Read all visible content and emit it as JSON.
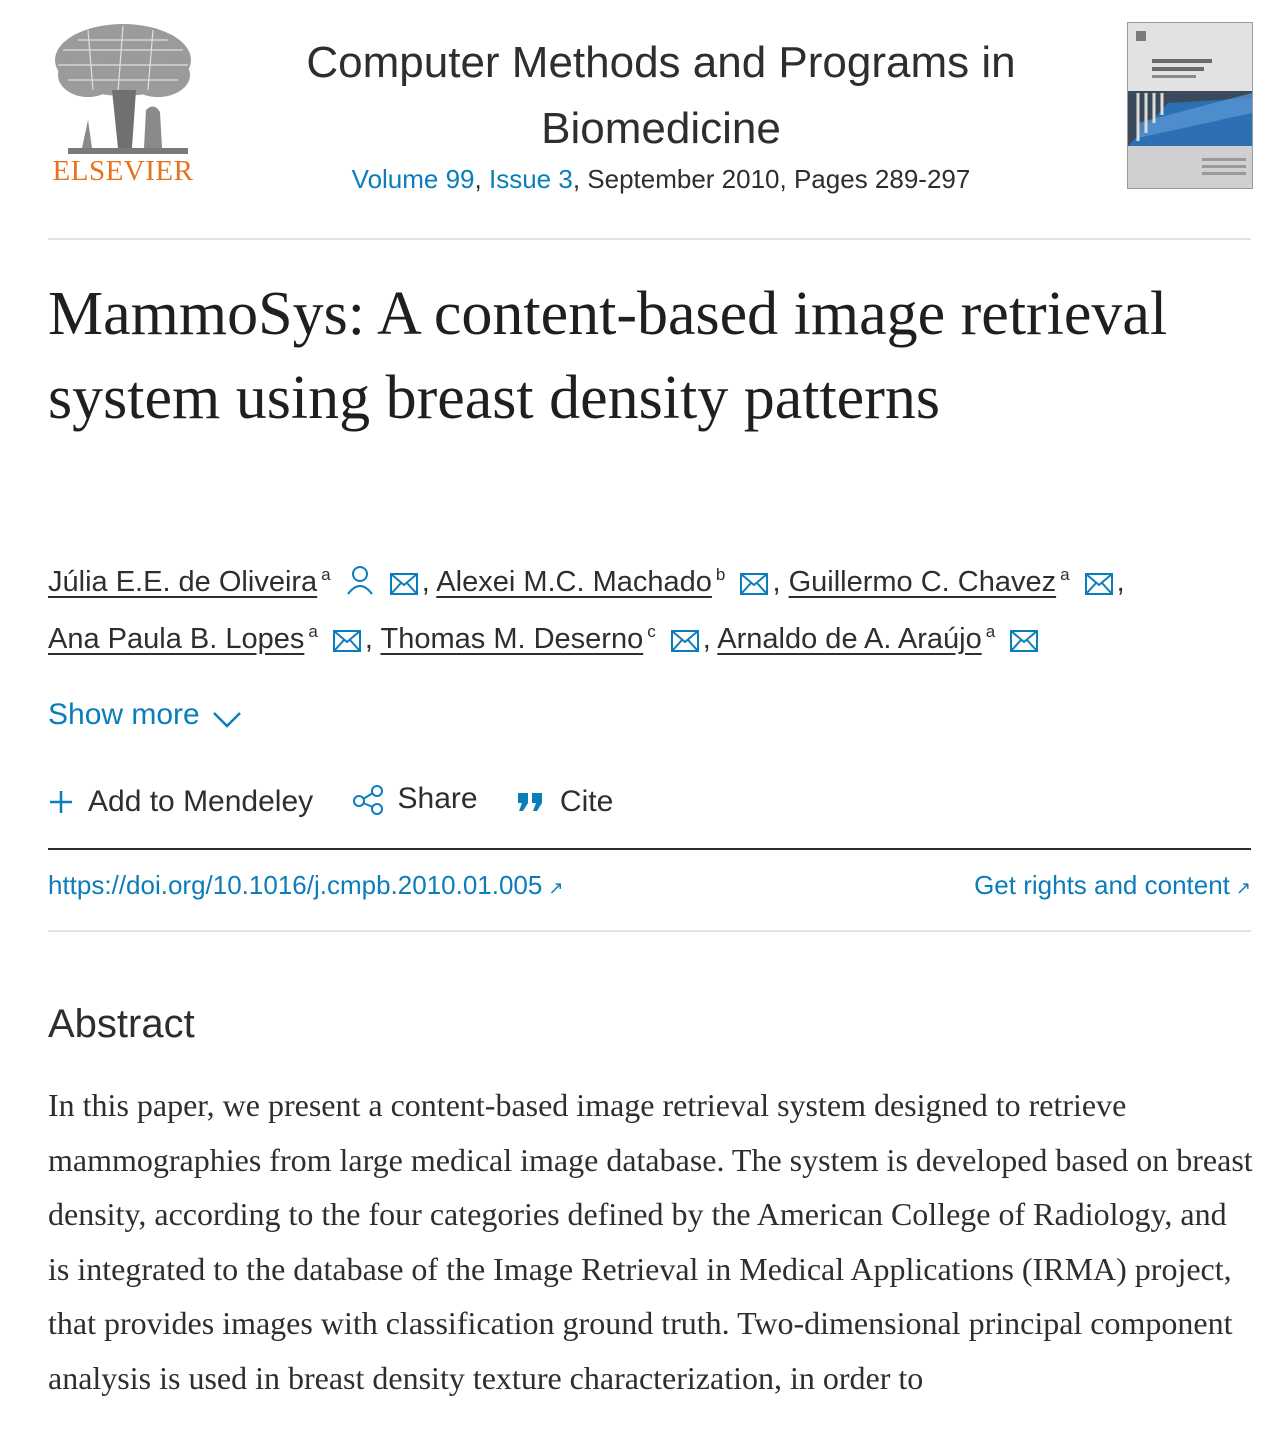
{
  "header": {
    "publisher": "ELSEVIER",
    "journal_title": "Computer Methods and Programs in Biomedicine",
    "volume_label": "Volume 99",
    "issue_label": "Issue 3",
    "sep": ",",
    "date_pages": ", September 2010, Pages 289-297"
  },
  "article": {
    "title": "MammoSys: A content-based image retrieval system using breast density patterns",
    "authors": [
      {
        "name": "Júlia E.E. de Oliveira",
        "aff": "a"
      },
      {
        "name": "Alexei M.C. Machado",
        "aff": "b"
      },
      {
        "name": "Guillermo C. Chavez",
        "aff": "a"
      },
      {
        "name": "Ana Paula B. Lopes",
        "aff": "a"
      },
      {
        "name": "Thomas M. Deserno",
        "aff": "c"
      },
      {
        "name": "Arnaldo de A. Araújo",
        "aff": "a"
      }
    ],
    "comma": ","
  },
  "show_more": "Show more",
  "actions": {
    "mendeley": "Add to Mendeley",
    "share": "Share",
    "cite": "Cite"
  },
  "doi": "https://doi.org/10.1016/j.cmpb.2010.01.005",
  "rights": "Get rights and content",
  "ext_arrow": "↗",
  "abstract": {
    "heading": "Abstract",
    "text": "In this paper, we present a content-based image retrieval system designed to retrieve mammographies from large medical image database. The system is developed based on breast density, according to the four categories defined by the American College of Radiology, and is integrated to the database of the Image Retrieval in Medical Applications (IRMA) project, that provides images with classification ground truth. Two-dimensional principal component analysis is used in breast density texture characterization, in order to"
  },
  "colors": {
    "link": "#0c7dbb",
    "text": "#2e2e2e",
    "elsevier_orange": "#e9711c"
  }
}
